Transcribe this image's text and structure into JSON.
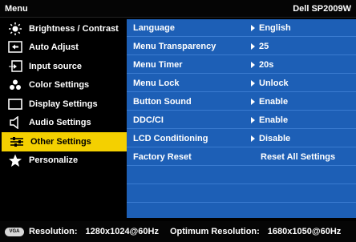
{
  "header": {
    "menu_label": "Menu",
    "model": "Dell SP2009W"
  },
  "sidebar": {
    "items": [
      {
        "label": "Brightness / Contrast",
        "icon": "brightness-icon"
      },
      {
        "label": "Auto Adjust",
        "icon": "auto-adjust-icon"
      },
      {
        "label": "Input source",
        "icon": "input-source-icon"
      },
      {
        "label": "Color Settings",
        "icon": "color-settings-icon"
      },
      {
        "label": "Display Settings",
        "icon": "display-settings-icon"
      },
      {
        "label": "Audio Settings",
        "icon": "speaker-icon"
      },
      {
        "label": "Other Settings",
        "icon": "sliders-icon",
        "selected": true
      },
      {
        "label": "Personalize",
        "icon": "star-icon"
      }
    ]
  },
  "settings": {
    "rows": [
      {
        "label": "Language",
        "value": "English",
        "arrow": true
      },
      {
        "label": "Menu Transparency",
        "value": "25",
        "arrow": true
      },
      {
        "label": "Menu Timer",
        "value": "20s",
        "arrow": true
      },
      {
        "label": "Menu Lock",
        "value": "Unlock",
        "arrow": true
      },
      {
        "label": "Button Sound",
        "value": "Enable",
        "arrow": true
      },
      {
        "label": "DDC/CI",
        "value": "Enable",
        "arrow": true
      },
      {
        "label": "LCD Conditioning",
        "value": "Disable",
        "arrow": true
      },
      {
        "label": "Factory Reset",
        "value": "Reset All Settings",
        "arrow": false
      }
    ]
  },
  "footer": {
    "connector_icon": "vga-connector-icon",
    "connector_text": "VGA",
    "resolution_label": "Resolution:",
    "resolution_value": "1280x1024@60Hz",
    "optimum_label": "Optimum Resolution:",
    "optimum_value": "1680x1050@60Hz"
  },
  "colors": {
    "panel": "#1d5fb6",
    "selected": "#f4d000",
    "background": "#000000"
  }
}
